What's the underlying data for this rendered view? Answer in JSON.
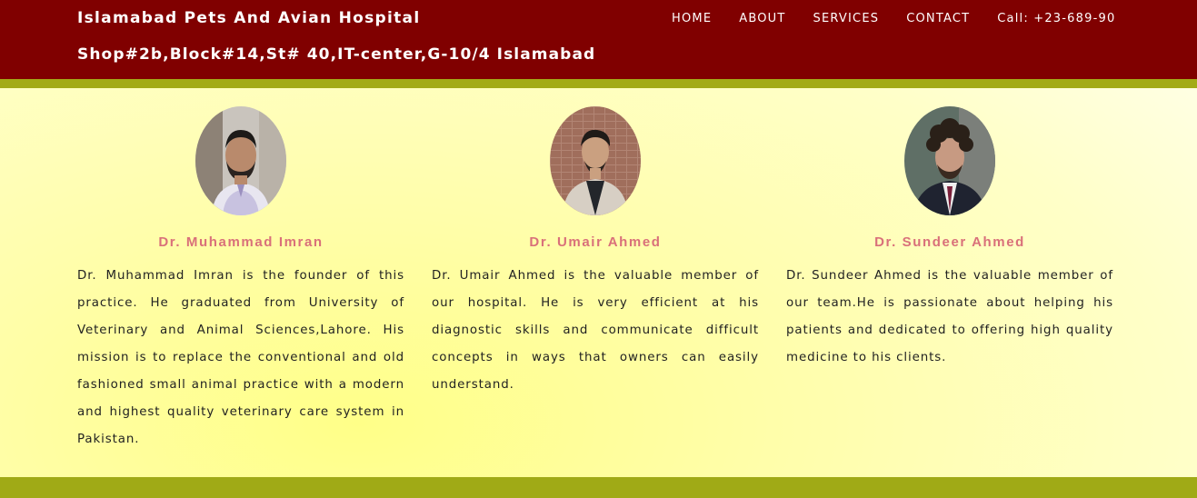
{
  "header": {
    "title": "Islamabad Pets And Avian Hospital",
    "address": "Shop#2b,Block#14,St# 40,IT-center,G-10/4 Islamabad",
    "nav": {
      "home": "HOME",
      "about": "ABOUT",
      "services": "SERVICES",
      "contact": "CONTACT",
      "call": "Call: +23-689-90"
    },
    "colors": {
      "bar": "#800000",
      "stripe": "#a3ab17"
    }
  },
  "doctors": [
    {
      "name": "Dr. Muhammad Imran",
      "bio": "Dr. Muhammad Imran is the founder of this practice. He graduated from University of Veterinary and Animal Sciences,Lahore. His mission is to replace the conventional and old fashioned small animal practice with a modern and highest quality veterinary care system in Pakistan.",
      "photo_icon": "doctor-photo"
    },
    {
      "name": "Dr. Umair Ahmed",
      "bio": "Dr. Umair Ahmed is the valuable member of our hospital. He is very efficient at his diagnostic skills and communicate difficult concepts in ways that owners can easily understand.",
      "photo_icon": "doctor-photo"
    },
    {
      "name": "Dr. Sundeer Ahmed",
      "bio": "Dr. Sundeer Ahmed is the valuable member of our team.He is passionate about helping his patients and dedicated to offering high quality medicine to his clients.",
      "photo_icon": "doctor-photo"
    }
  ]
}
